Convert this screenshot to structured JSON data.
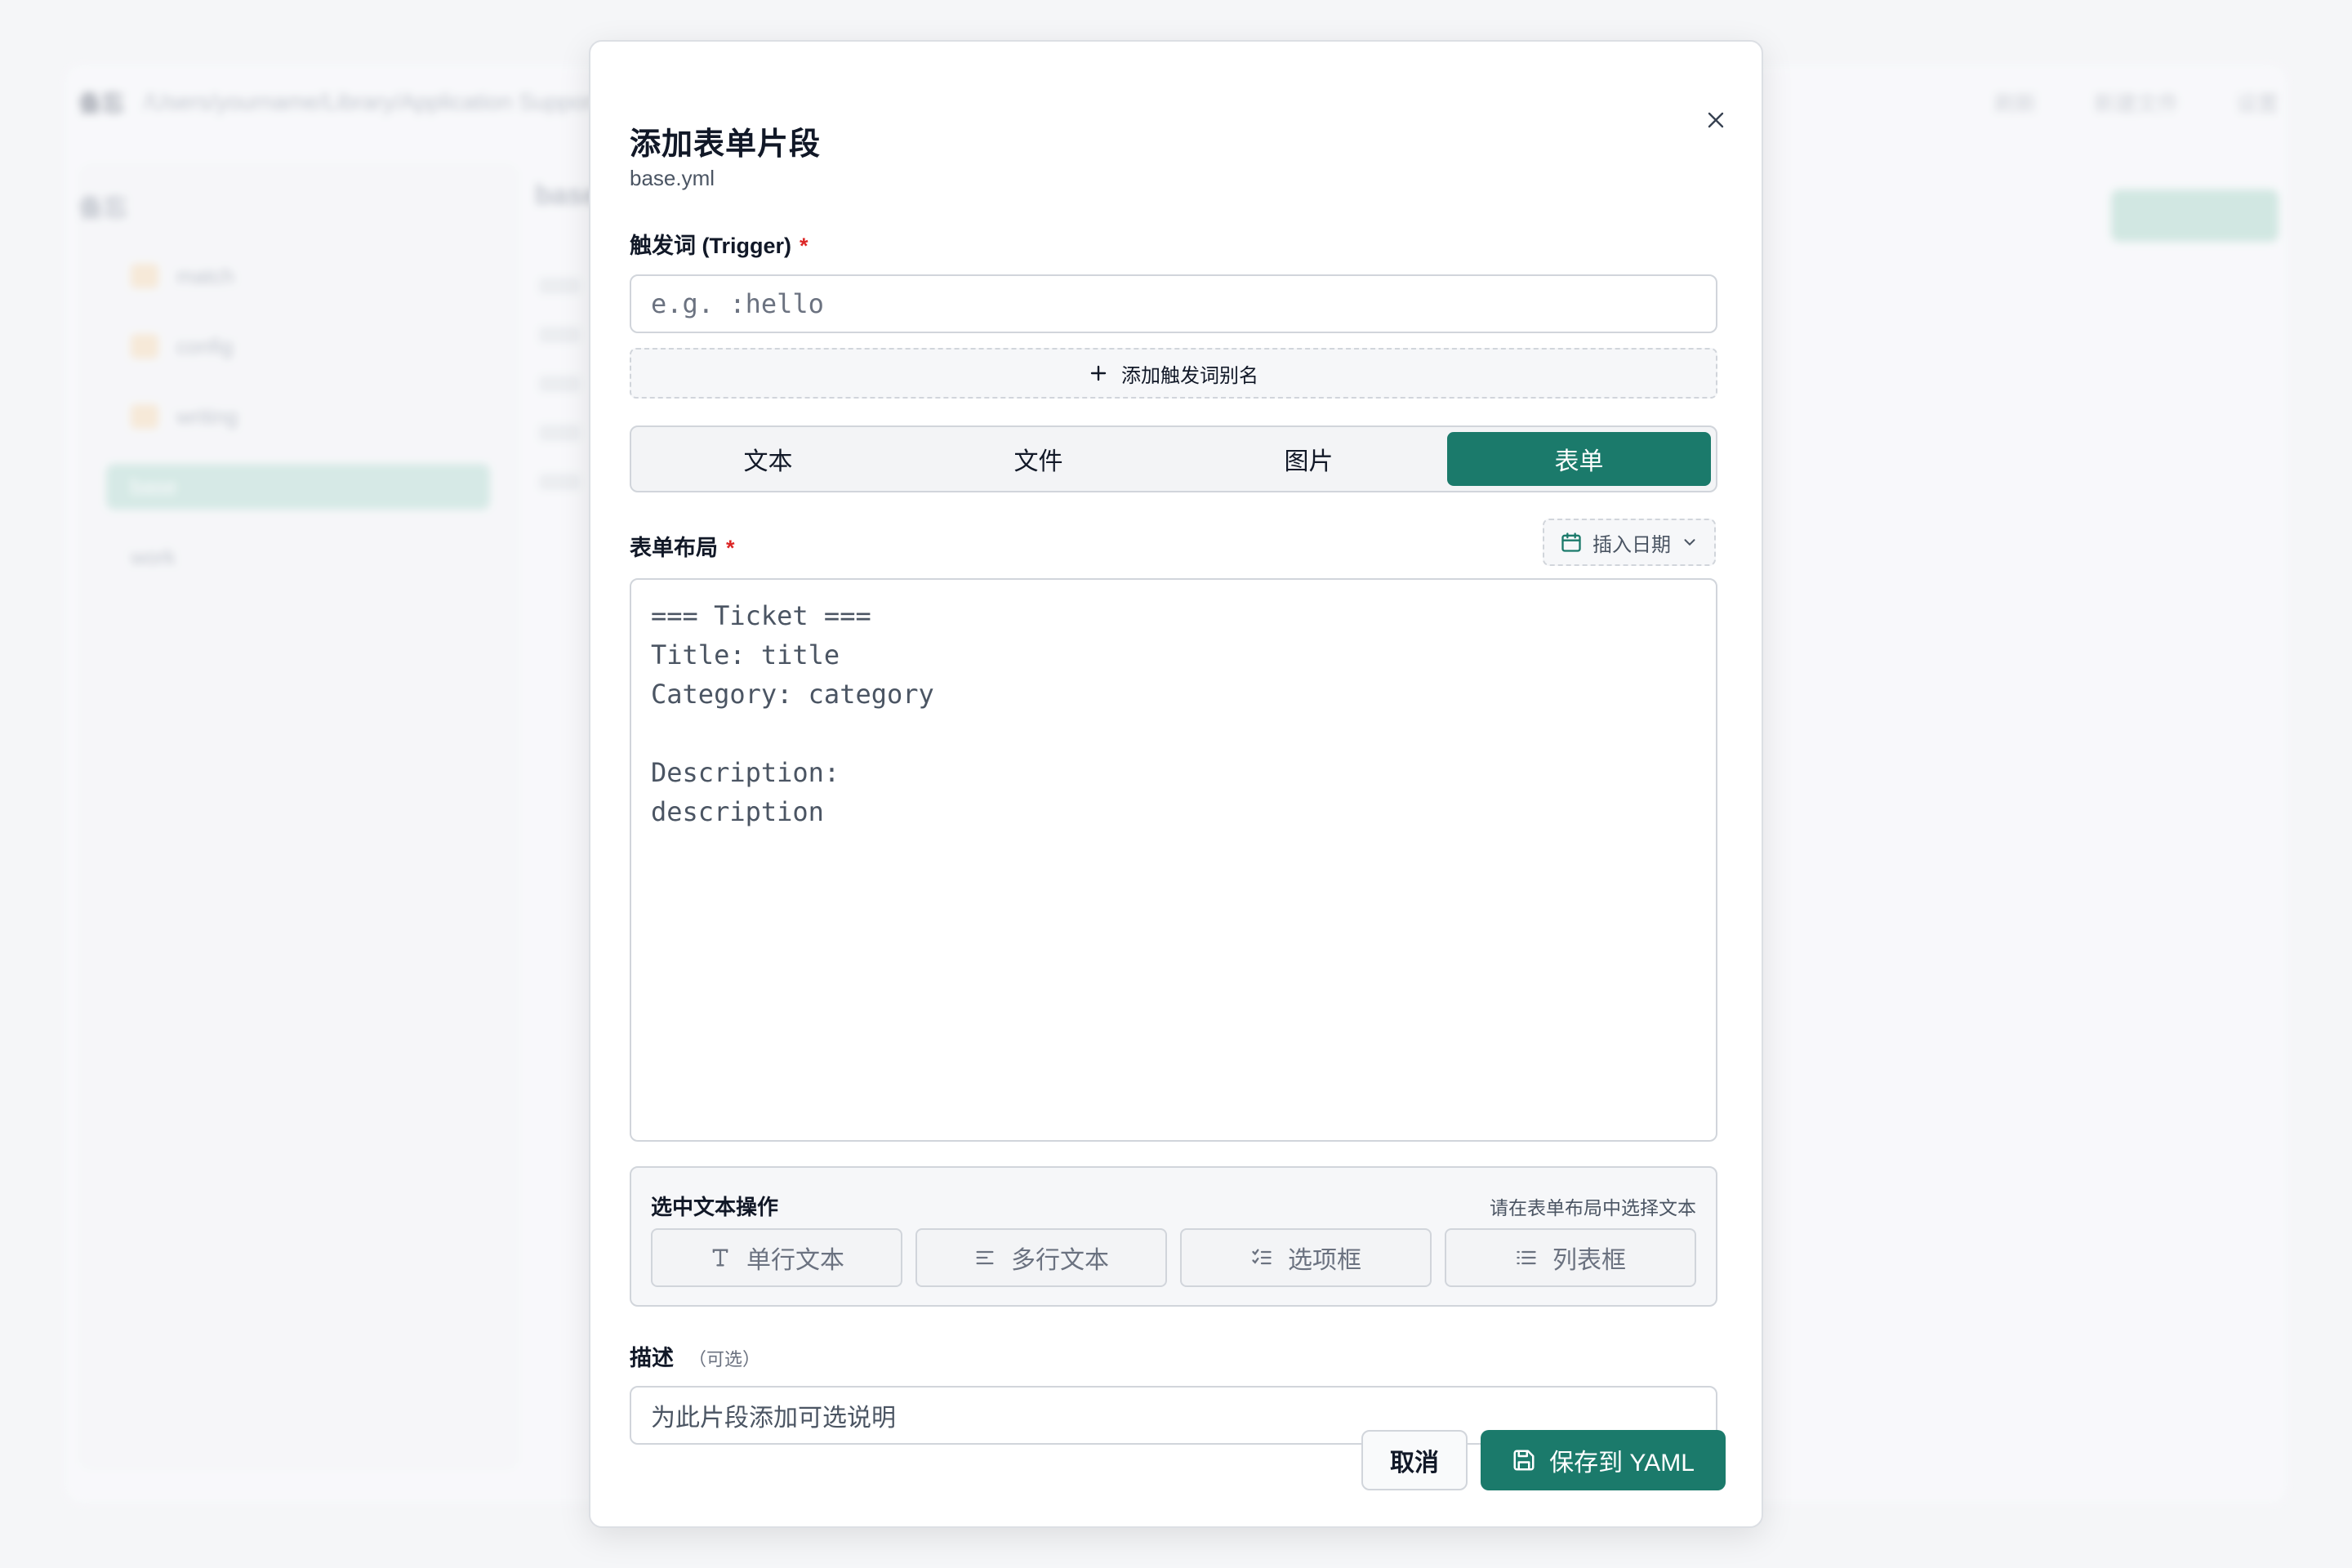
{
  "background": {
    "header_title": "备忘",
    "header_path": "/Users/yourname/Library/Application Support/espanso",
    "header_actions": [
      "刷新",
      "新建文件",
      "设置"
    ],
    "sidebar_title": "备忘",
    "tree_items": [
      "match",
      "config",
      "writing",
      "base",
      "work"
    ],
    "main_title": "base"
  },
  "modal": {
    "title": "添加表单片段",
    "subtitle": "base.yml",
    "trigger": {
      "label": "触发词 (Trigger)",
      "required_mark": "*",
      "placeholder": "e.g. :hello",
      "add_alias_label": "添加触发词别名"
    },
    "tabs": [
      {
        "label": "文本",
        "active": false
      },
      {
        "label": "文件",
        "active": false
      },
      {
        "label": "图片",
        "active": false
      },
      {
        "label": "表单",
        "active": true
      }
    ],
    "layout": {
      "label": "表单布局",
      "required_mark": "*",
      "insert_date_label": "插入日期",
      "content": "=== Ticket ===\nTitle: title\nCategory: category\n\nDescription:\ndescription"
    },
    "selection": {
      "title": "选中文本操作",
      "hint": "请在表单布局中选择文本",
      "buttons": [
        {
          "label": "单行文本",
          "icon": "text-type-icon"
        },
        {
          "label": "多行文本",
          "icon": "align-left-icon"
        },
        {
          "label": "选项框",
          "icon": "list-checks-icon"
        },
        {
          "label": "列表框",
          "icon": "list-icon"
        }
      ]
    },
    "description": {
      "label": "描述",
      "optional_hint": "（可选）",
      "placeholder": "为此片段添加可选说明"
    },
    "footer": {
      "cancel_label": "取消",
      "save_label": "保存到 YAML"
    }
  },
  "colors": {
    "accent": "#1b7a6b",
    "required": "#dc2626"
  }
}
